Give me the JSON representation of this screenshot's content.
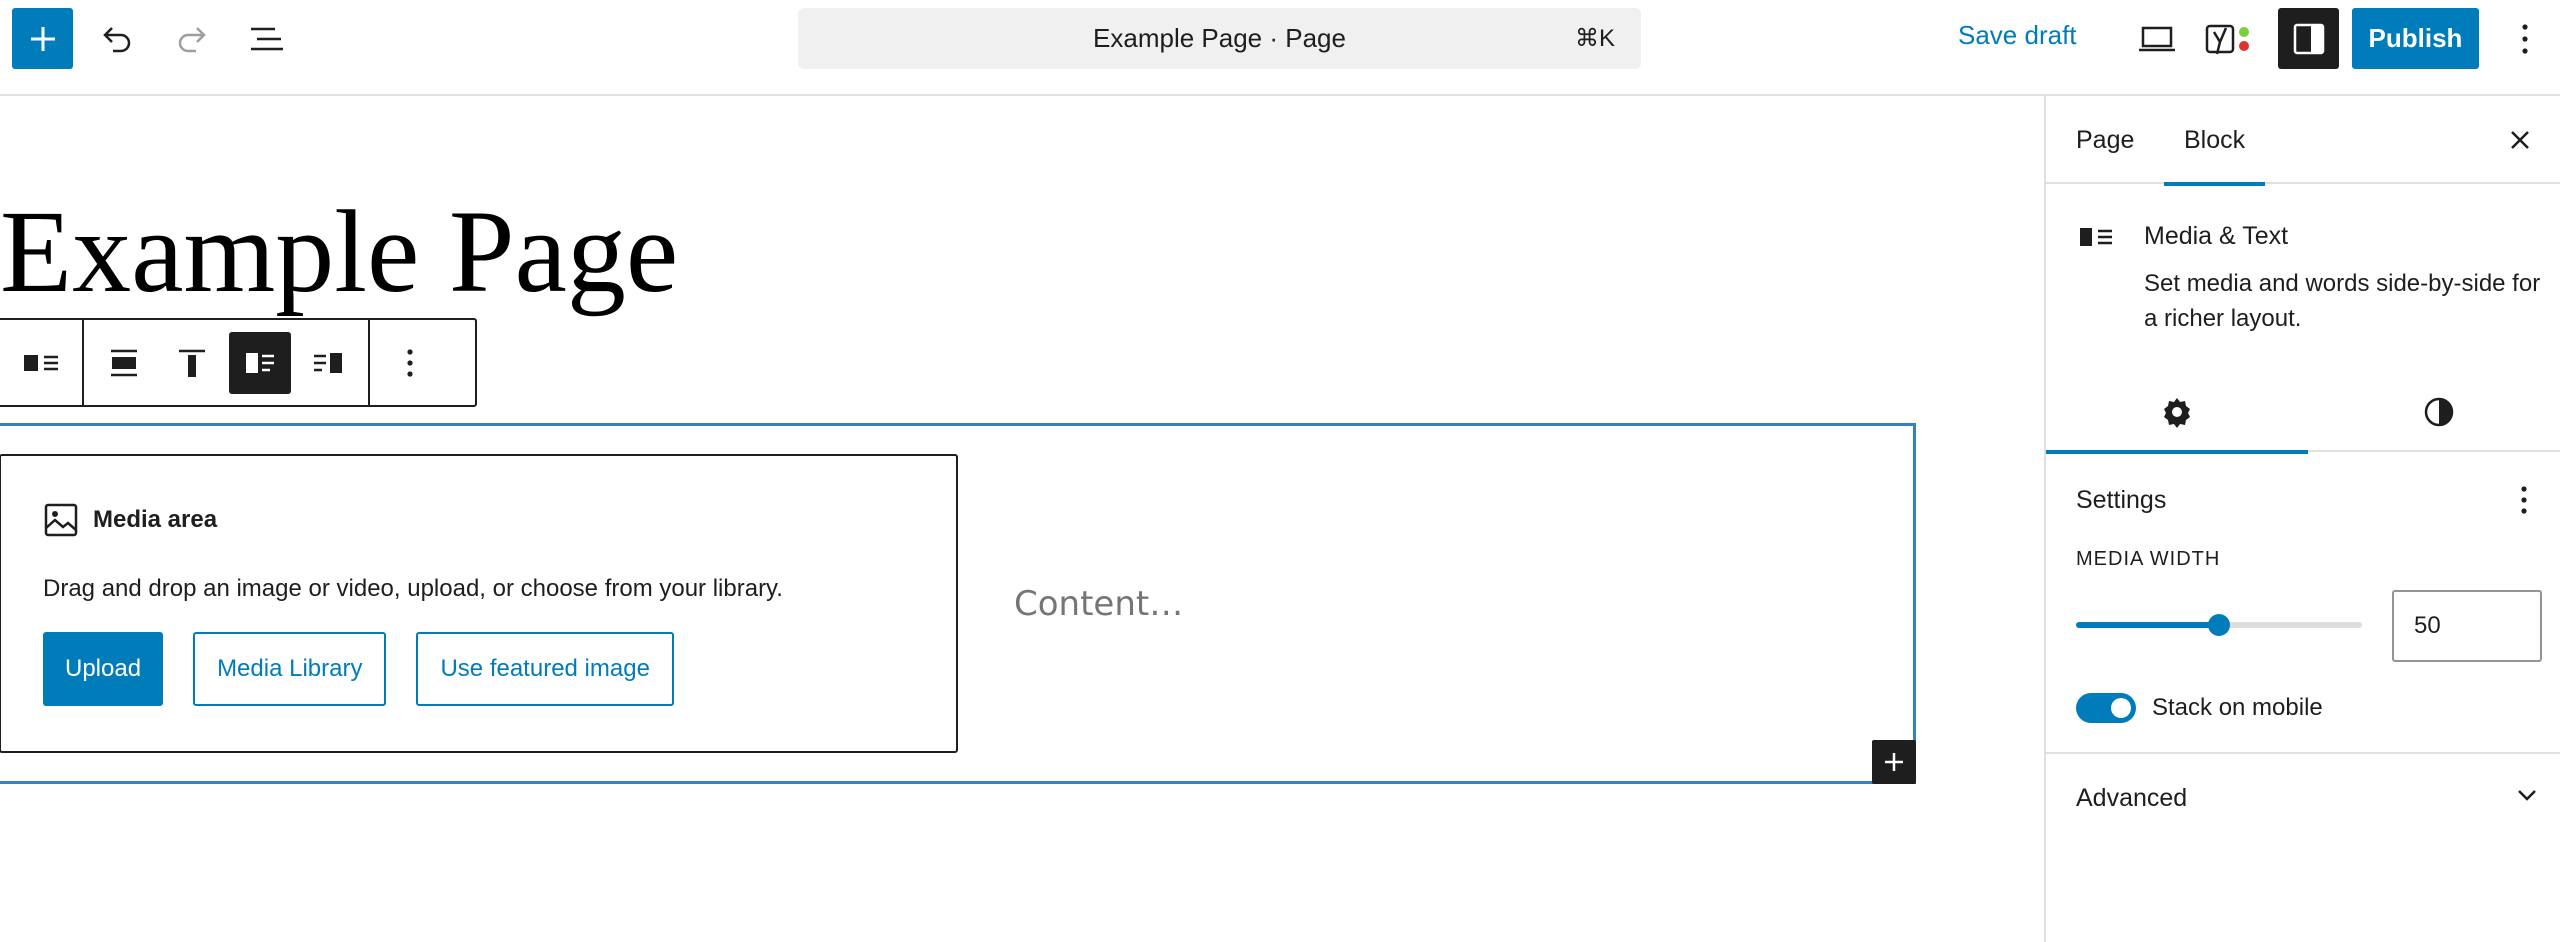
{
  "topbar": {
    "document_title": "Example Page · Page",
    "shortcut": "⌘K",
    "save_draft": "Save draft",
    "publish": "Publish"
  },
  "canvas": {
    "page_title": "Example Page",
    "media_area": {
      "label": "Media area",
      "instructions": "Drag and drop an image or video, upload, or choose from your library.",
      "upload": "Upload",
      "media_library": "Media Library",
      "featured_image": "Use featured image"
    },
    "content_placeholder": "Content…"
  },
  "sidebar": {
    "tabs": [
      "Page",
      "Block"
    ],
    "active_tab": "Block",
    "block_card": {
      "title": "Media & Text",
      "description": "Set media and words side-by-side for a richer layout."
    },
    "settings_panel": {
      "title": "Settings",
      "media_width_label": "MEDIA WIDTH",
      "media_width_value": "50",
      "stack_on_mobile_label": "Stack on mobile",
      "stack_on_mobile": true
    },
    "advanced": {
      "title": "Advanced"
    }
  },
  "colors": {
    "accent": "#007cba",
    "dark": "#1e1e1e",
    "selection_border": "#3583b9"
  }
}
